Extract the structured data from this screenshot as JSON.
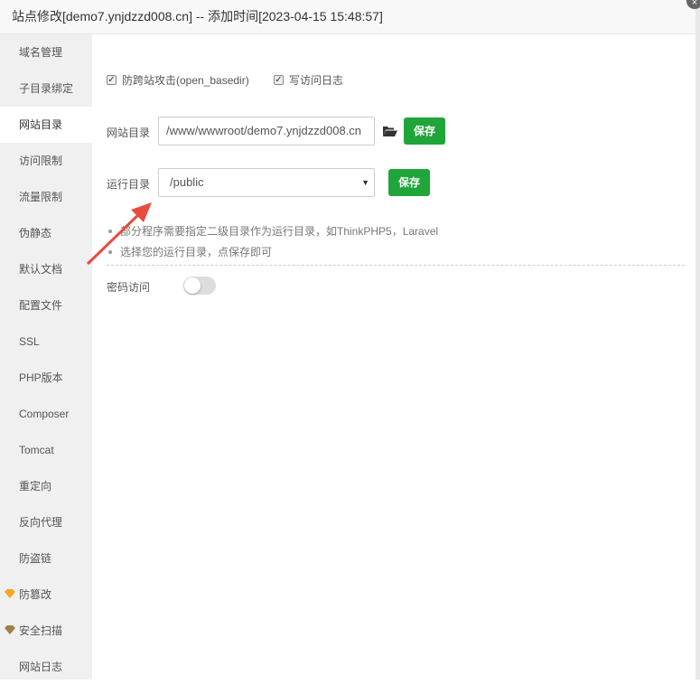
{
  "window": {
    "title": "站点修改[demo7.ynjdzzd008.cn] -- 添加时间[2023-04-15 15:48:57]",
    "close_icon": "×"
  },
  "sidebar": {
    "items": [
      {
        "label": "域名管理"
      },
      {
        "label": "子目录绑定"
      },
      {
        "label": "网站目录",
        "active": true
      },
      {
        "label": "访问限制"
      },
      {
        "label": "流量限制"
      },
      {
        "label": "伪静态"
      },
      {
        "label": "默认文档"
      },
      {
        "label": "配置文件"
      },
      {
        "label": "SSL"
      },
      {
        "label": "PHP版本"
      },
      {
        "label": "Composer"
      },
      {
        "label": "Tomcat"
      },
      {
        "label": "重定向"
      },
      {
        "label": "反向代理"
      },
      {
        "label": "防盗链"
      },
      {
        "label": "防篡改",
        "icon": "gem-icon",
        "icon_color": "#f5a623"
      },
      {
        "label": "安全扫描",
        "icon": "gem-icon",
        "icon_color": "#a08050"
      },
      {
        "label": "网站日志"
      }
    ]
  },
  "main": {
    "anti_xss": {
      "label": "防跨站攻击(open_basedir)",
      "checked": true
    },
    "access_log": {
      "label": "写访问日志",
      "checked": true
    },
    "site_dir": {
      "label": "网站目录",
      "value": "/www/wwwroot/demo7.ynjdzzd008.cn",
      "save": "保存"
    },
    "run_dir": {
      "label": "运行目录",
      "value": "/public",
      "save": "保存"
    },
    "tips": [
      "部分程序需要指定二级目录作为运行目录，如ThinkPHP5，Laravel",
      "选择您的运行目录，点保存即可"
    ],
    "password_access": {
      "label": "密码访问",
      "enabled": false
    }
  },
  "colors": {
    "accent": "#20a53a",
    "annotation_arrow": "#e84c3d"
  }
}
